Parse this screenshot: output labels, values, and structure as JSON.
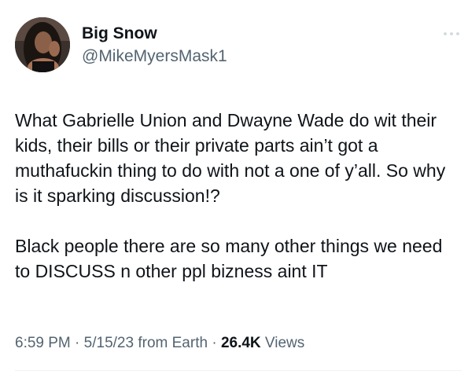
{
  "author": {
    "display_name": "Big Snow",
    "handle": "@MikeMyersMask1"
  },
  "tweet": {
    "text": "What Gabrielle Union and Dwayne Wade do wit their kids, their bills or their private parts ain’t got a muthafuckin thing to do with not a one of y’all. So why is it sparking discussion!?\n\nBlack people there are so many other things we need to DISCUSS n other ppl bizness aint IT"
  },
  "meta": {
    "time": "6:59 PM",
    "separator": "·",
    "date": "5/15/23",
    "source": "from Earth",
    "views_count": "26.4K",
    "views_label": "Views"
  },
  "icons": {
    "more": "more-horizontal-icon",
    "avatar": "user-avatar-photo"
  },
  "colors": {
    "primary_text": "#0f1419",
    "secondary_text": "#536471",
    "divider": "#eff3f4",
    "more_icon": "#cfd9de"
  }
}
